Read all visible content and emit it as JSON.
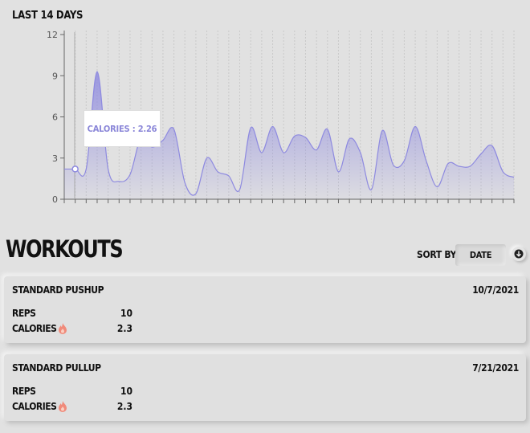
{
  "chart_section": {
    "title": "LAST 14 DAYS",
    "tooltip_label": "CALORIES",
    "tooltip_value": "2.26"
  },
  "chart_data": {
    "type": "area",
    "ylim": [
      0,
      12
    ],
    "yticks": [
      "0",
      "3",
      "6",
      "9",
      "12"
    ],
    "values": [
      2.2,
      2.2,
      2.2,
      9.3,
      2.2,
      1.3,
      1.8,
      4.5,
      3.8,
      4.3,
      5.1,
      1.2,
      0.4,
      3.0,
      2.0,
      1.7,
      0.7,
      5.2,
      3.4,
      5.3,
      3.4,
      4.6,
      4.5,
      3.6,
      5.1,
      2.0,
      4.4,
      3.4,
      0.7,
      5.0,
      2.5,
      2.8,
      5.3,
      2.8,
      0.9,
      2.6,
      2.4,
      2.4,
      3.3,
      3.9,
      2.0,
      1.6
    ],
    "highlight_index": 1,
    "line_color": "#8e8ae0",
    "fill_color": "#8e8ae0"
  },
  "workouts": {
    "title": "WORKOUTS",
    "sort_label": "SORT BY",
    "sort_value": "DATE",
    "items": [
      {
        "name": "STANDARD PUSHUP",
        "date": "10/7/2021",
        "reps_label": "REPS",
        "reps": "10",
        "calories_label": "CALORIES",
        "calories": "2.3"
      },
      {
        "name": "STANDARD PULLUP",
        "date": "7/21/2021",
        "reps_label": "REPS",
        "reps": "10",
        "calories_label": "CALORIES",
        "calories": "2.3"
      }
    ]
  }
}
